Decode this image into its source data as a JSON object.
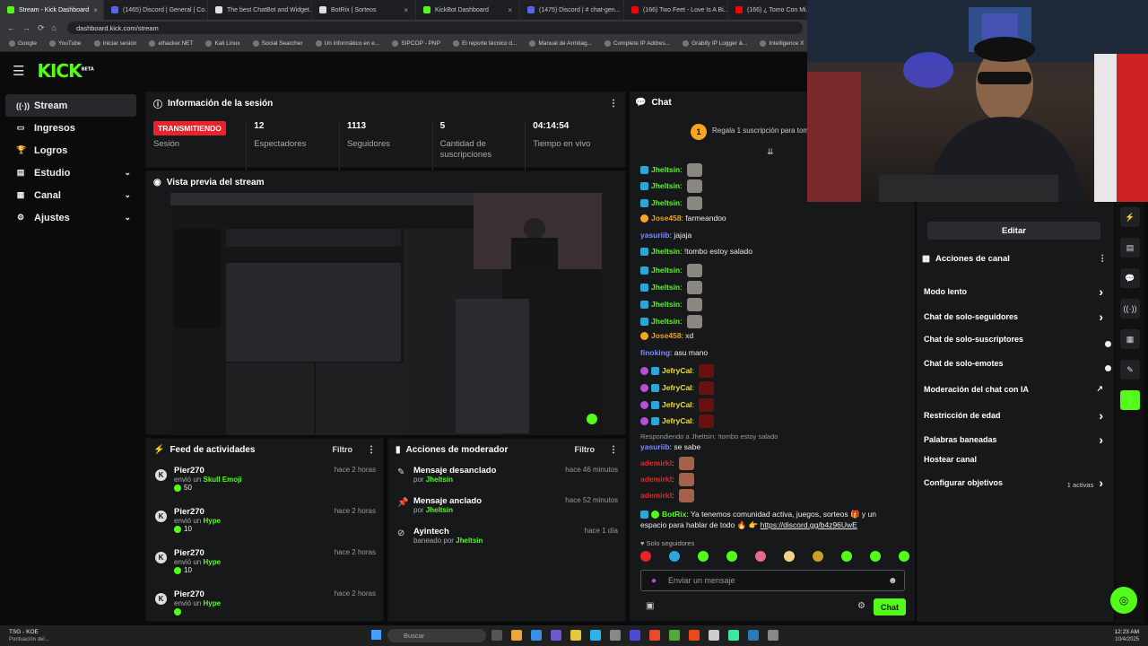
{
  "browser": {
    "tabs": [
      {
        "label": "Stream - Kick Dashboard",
        "color": "#53fc18",
        "active": true
      },
      {
        "label": "(1465) Discord | General | Co...",
        "color": "#5865f2"
      },
      {
        "label": "The best ChatBot and Widget...",
        "color": "#e0e0e0"
      },
      {
        "label": "BotRix | Sorteos",
        "color": "#e0e0e0"
      },
      {
        "label": "KickBot Dashboard",
        "color": "#53fc18"
      },
      {
        "label": "(1475) Discord | # chat-gen...",
        "color": "#5865f2"
      },
      {
        "label": "(166) Two Feet - Love Is A Bi...",
        "color": "#ff0000"
      },
      {
        "label": "(166) ¿ Tomo Con Mi...",
        "color": "#ff0000"
      }
    ],
    "url": "dashboard.kick.com/stream",
    "bookmarks": [
      "Google",
      "YouTube",
      "Iniciar sesión",
      "elhacker.NET",
      "Kali Linux",
      "Social Searcher",
      "Un informático en e...",
      "SIPCOP - PNP",
      "El reporte técnico d...",
      "Manual de Armitag...",
      "Complete IP Addres...",
      "Grabify IP Logger &...",
      "Intelligence X",
      "Online investigation..."
    ]
  },
  "nav": {
    "logo": "KICK",
    "logo_sup": "BETA"
  },
  "sidebar": {
    "items": [
      {
        "label": "Stream",
        "icon": "radio-icon"
      },
      {
        "label": "Ingresos",
        "icon": "card-icon"
      },
      {
        "label": "Logros",
        "icon": "trophy-icon"
      },
      {
        "label": "Estudio",
        "icon": "studio-icon"
      },
      {
        "label": "Canal",
        "icon": "channel-icon"
      },
      {
        "label": "Ajustes",
        "icon": "gear-icon"
      }
    ]
  },
  "session": {
    "title": "Información de la sesión",
    "live_badge": "TRANSMITIENDO",
    "live_label": "Sesión",
    "viewers": "12",
    "viewers_label": "Espectadores",
    "followers": "1113",
    "followers_label": "Seguidores",
    "subs": "5",
    "subs_label": "Cantidad de suscripciones",
    "uptime": "04:14:54",
    "uptime_label": "Tiempo en vivo"
  },
  "preview": {
    "title": "Vista previa del stream"
  },
  "feed": {
    "title": "Feed de actividades",
    "filter": "Filtro",
    "items": [
      {
        "user": "Pier270",
        "action": "envió un",
        "item": "Skull Emoji",
        "value": "50",
        "time": "hace 2 horas"
      },
      {
        "user": "Pier270",
        "action": "envió un",
        "item": "Hype",
        "value": "10",
        "time": "hace 2 horas"
      },
      {
        "user": "Pier270",
        "action": "envió un",
        "item": "Hype",
        "value": "10",
        "time": "hace 2 horas"
      },
      {
        "user": "Pier270",
        "action": "envió un",
        "item": "Hype",
        "value": "",
        "time": "hace 2 horas"
      }
    ]
  },
  "mod": {
    "title": "Acciones de moderador",
    "filter": "Filtro",
    "items": [
      {
        "title": "Mensaje desanclado",
        "by": "por",
        "user": "Jheltsin",
        "time": "hace 46 minutos"
      },
      {
        "title": "Mensaje anclado",
        "by": "por",
        "user": "Jheltsin",
        "time": "hace 52 minutos"
      },
      {
        "title": "Ayintech",
        "by": "baneado por",
        "user": "Jheltsin",
        "time": "hace 1 día"
      }
    ]
  },
  "chat": {
    "title": "Chat",
    "pinned_count": "1",
    "pinned_text": "Regala 1 suscripción para tom",
    "messages": [
      {
        "user": "Jheltsin",
        "color": "#53fc18",
        "text": "",
        "emote": "gray"
      },
      {
        "user": "Jheltsin",
        "color": "#53fc18",
        "text": "",
        "emote": "gray"
      },
      {
        "user": "Jheltsin",
        "color": "#53fc18",
        "text": "",
        "emote": "gray"
      },
      {
        "user": "Jose458",
        "color": "#f0a01e",
        "text": "farmeandoo",
        "emote": ""
      },
      {
        "user": "yasuriib",
        "color": "#7a8cff",
        "text": "jajaja",
        "emote": ""
      },
      {
        "user": "Jheltsin",
        "color": "#53fc18",
        "text": "!tombo estoy salado",
        "emote": ""
      },
      {
        "user": "Jheltsin",
        "color": "#53fc18",
        "text": "",
        "emote": "gray"
      },
      {
        "user": "Jheltsin",
        "color": "#53fc18",
        "text": "",
        "emote": "gray"
      },
      {
        "user": "Jheltsin",
        "color": "#53fc18",
        "text": "",
        "emote": "gray"
      },
      {
        "user": "Jheltsin",
        "color": "#53fc18",
        "text": "",
        "emote": "gray"
      },
      {
        "user": "Jose458",
        "color": "#f0a01e",
        "text": "xd",
        "emote": ""
      },
      {
        "user": "finoking",
        "color": "#7a8cff",
        "text": "asu mano",
        "emote": ""
      },
      {
        "user": "JefryCal",
        "color": "#f0e01e",
        "text": "",
        "emote": "red"
      },
      {
        "user": "JefryCal",
        "color": "#f0e01e",
        "text": "",
        "emote": "red"
      },
      {
        "user": "JefryCal",
        "color": "#f0e01e",
        "text": "",
        "emote": "red"
      },
      {
        "user": "JefryCal",
        "color": "#f0e01e",
        "text": "",
        "emote": "red"
      }
    ],
    "reply_note": "Respondiendo a Jheltsin: !tombo estoy salado",
    "reply_user": "yasuriib",
    "reply_text": "se sabe",
    "ademirk": [
      "ademirkl",
      "ademirkl",
      "ademirkl"
    ],
    "botrix_user": "BotRix",
    "botrix_text": "Ya tenemos comunidad activa, juegos, sorteos 🎁 y un",
    "botrix_text2": "espacio para hablar de todo 🔥 👉",
    "botrix_link": "https://discord.gg/b4z96UwE",
    "followers_only": "Solo seguidores",
    "input_placeholder": "Enviar un mensaje",
    "send_label": "Chat"
  },
  "actions": {
    "edit": "Editar",
    "title": "Acciones de canal",
    "items": [
      {
        "label": "Modo lento",
        "ctrl": "chevron"
      },
      {
        "label": "Chat de solo-seguidores",
        "ctrl": "chevron"
      },
      {
        "label": "Chat de solo-suscriptores",
        "ctrl": "toggle"
      },
      {
        "label": "Chat de solo-emotes",
        "ctrl": "toggle"
      },
      {
        "label": "Moderación del chat con IA",
        "ctrl": "external"
      },
      {
        "label": "Restricción de edad",
        "ctrl": "chevron"
      },
      {
        "label": "Palabras baneadas",
        "ctrl": "chevron"
      },
      {
        "label": "Hostear canal",
        "ctrl": "none"
      },
      {
        "label": "Configurar objetivos",
        "ctrl": "chevron"
      }
    ],
    "goals_active": "1 activas"
  },
  "taskbar": {
    "app_title": "TSG - KOE",
    "app_sub": "Puntuación del...",
    "search": "Buscar",
    "time": "12:23 AM",
    "date": "10/4/2025"
  }
}
